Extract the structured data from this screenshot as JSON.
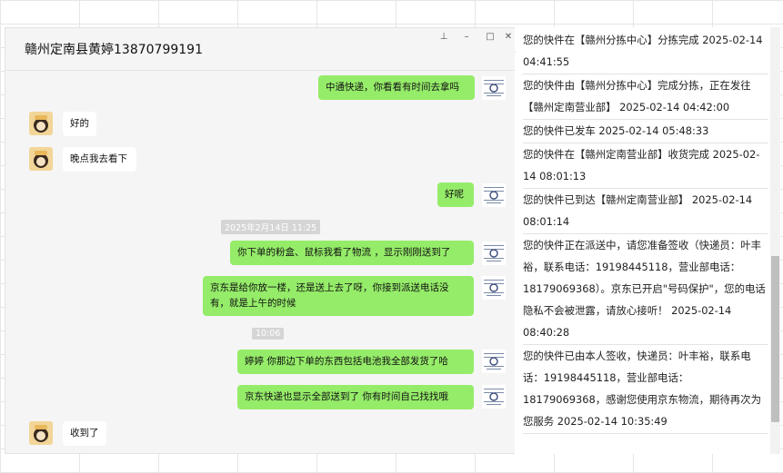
{
  "chat": {
    "title": "赣州定南县黄婷13870799191",
    "window_buttons": {
      "pin": "⊥",
      "minimize": "–",
      "maximize": "□",
      "close": "✕"
    },
    "messages": [
      {
        "side": "out",
        "text": "中通快递，你看看有时间去拿吗"
      },
      {
        "side": "in",
        "text": "好的"
      },
      {
        "side": "in",
        "text": "晚点我去看下"
      },
      {
        "side": "out",
        "text": "好呢"
      },
      {
        "type": "time",
        "text": "2025年2月14日 11:25"
      },
      {
        "side": "out",
        "text": "你下单的粉盒、鼠标我看了物流 ，显示刚刚送到了"
      },
      {
        "side": "out",
        "text": "京东是给你放一楼，还是送上去了呀，你接到派送电话没有，就是上午的时候"
      },
      {
        "type": "time",
        "text": "10:06"
      },
      {
        "side": "out",
        "text": "婷婷  你那边下单的东西包括电池我全部发货了哈"
      },
      {
        "side": "out",
        "text": "京东快递也显示全部送到了  你有时间自己找找哦"
      },
      {
        "side": "in",
        "text": "收到了"
      }
    ]
  },
  "tracking": {
    "more_icon": "more-dots-icon",
    "entries": [
      "您的快件在【赣州分拣中心】分拣完成 2025-02-14 04:41:55",
      "您的快件由【赣州分拣中心】完成分拣，正在发往【赣州定南营业部】 2025-02-14 04:42:00",
      "您的快件已发车 2025-02-14 05:48:33",
      "您的快件在【赣州定南营业部】收货完成 2025-02-14 08:01:13",
      "您的快件已到达【赣州定南营业部】 2025-02-14 08:01:14",
      "您的快件正在派送中，请您准备签收（快递员：叶丰裕，联系电话：19198445118，营业部电话：18179069368）。京东已开启\"号码保护\"，您的电话隐私不会被泄露，请放心接听！ 2025-02-14 08:40:28",
      "您的快件已由本人签收，快递员：叶丰裕，联系电话：19198445118，营业部电话：18179069368，感谢您使用京东物流，期待再次为您服务 2025-02-14 10:35:49"
    ]
  },
  "colors": {
    "outgoing_bubble": "#95ec69",
    "incoming_bubble": "#ffffff",
    "chat_bg": "#f5f5f5"
  }
}
